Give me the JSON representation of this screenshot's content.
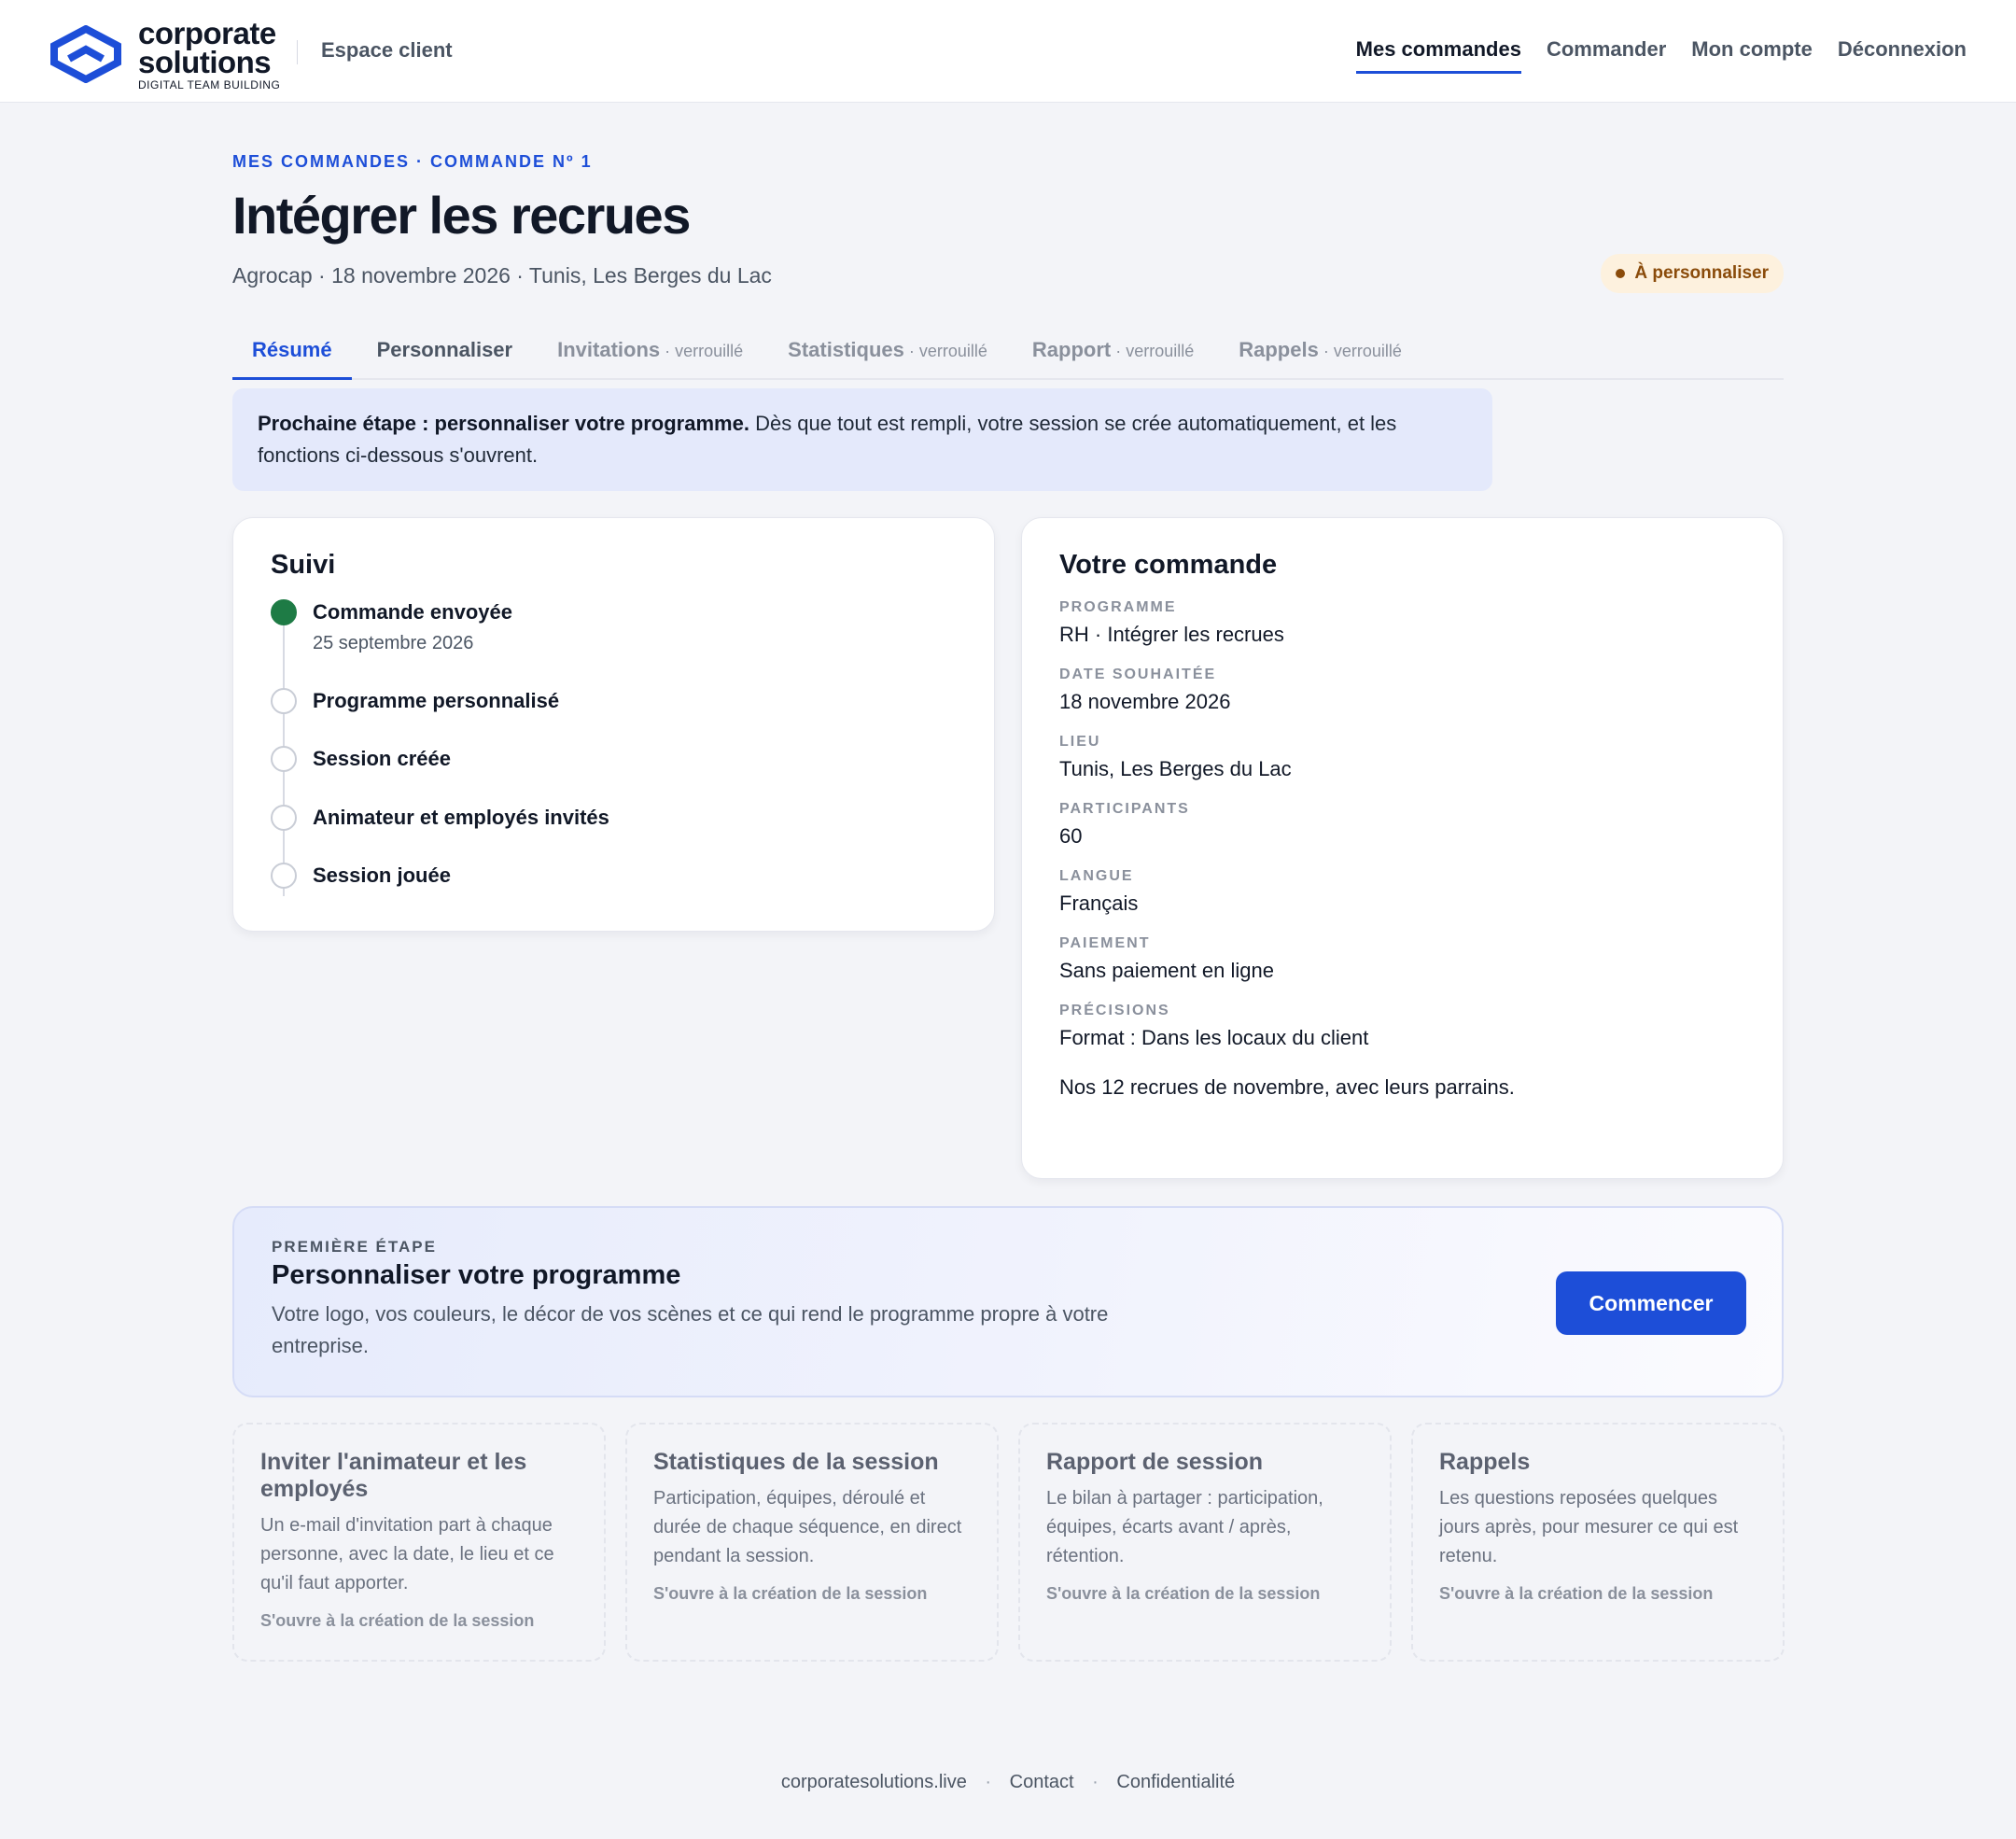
{
  "header": {
    "logo_word_1": "corporate",
    "logo_word_2": "solutions",
    "logo_tagline": "DIGITAL TEAM BUILDING",
    "section": "Espace client",
    "nav": [
      {
        "label": "Mes commandes",
        "active": true
      },
      {
        "label": "Commander"
      },
      {
        "label": "Mon compte"
      },
      {
        "label": "Déconnexion"
      }
    ]
  },
  "page": {
    "breadcrumb": "MES COMMANDES · COMMANDE Nº 1",
    "title": "Intégrer les recrues",
    "subtitle": "Agrocap · 18 novembre 2026 · Tunis, Les Berges du Lac",
    "status_badge": "À personnaliser"
  },
  "tabs": [
    {
      "label": "Résumé",
      "active": true
    },
    {
      "label": "Personnaliser"
    },
    {
      "label": "Invitations",
      "suffix": " · verrouillé"
    },
    {
      "label": "Statistiques",
      "suffix": " · verrouillé"
    },
    {
      "label": "Rapport",
      "suffix": " · verrouillé"
    },
    {
      "label": "Rappels",
      "suffix": " · verrouillé"
    }
  ],
  "banner": {
    "bold": "Prochaine étape : personnaliser votre programme.",
    "text": " Dès que tout est rempli, votre session se crée automatiquement, et les fonctions ci-dessous s'ouvrent."
  },
  "suivi": {
    "title": "Suivi",
    "steps": [
      {
        "label": "Commande envoyée",
        "date": "25 septembre 2026",
        "done": true
      },
      {
        "label": "Programme personnalisé"
      },
      {
        "label": "Session créée"
      },
      {
        "label": "Animateur et employés invités"
      },
      {
        "label": "Session jouée"
      }
    ]
  },
  "commande": {
    "title": "Votre commande",
    "fields": [
      {
        "label": "PROGRAMME",
        "value": "RH · Intégrer les recrues"
      },
      {
        "label": "DATE SOUHAITÉE",
        "value": "18 novembre 2026"
      },
      {
        "label": "LIEU",
        "value": "Tunis, Les Berges du Lac"
      },
      {
        "label": "PARTICIPANTS",
        "value": "60"
      },
      {
        "label": "LANGUE",
        "value": "Français"
      },
      {
        "label": "PAIEMENT",
        "value": "Sans paiement en ligne"
      },
      {
        "label": "PRÉCISIONS",
        "value": "Format : Dans les locaux du client"
      }
    ],
    "note": "Nos 12 recrues de novembre, avec leurs parrains."
  },
  "cta": {
    "eyebrow": "PREMIÈRE ÉTAPE",
    "title": "Personnaliser votre programme",
    "description": "Votre logo, vos couleurs, le décor de vos scènes et ce qui rend le programme propre à votre entreprise.",
    "button": "Commencer"
  },
  "features": [
    {
      "title": "Inviter l'animateur et les employés",
      "desc": "Un e-mail d'invitation part à chaque personne, avec la date, le lieu et ce qu'il faut apporter.",
      "foot": "S'ouvre à la création de la session"
    },
    {
      "title": "Statistiques de la session",
      "desc": "Participation, équipes, déroulé et durée de chaque séquence, en direct pendant la session.",
      "foot": "S'ouvre à la création de la session"
    },
    {
      "title": "Rapport de session",
      "desc": "Le bilan à partager : participation, équipes, écarts avant / après, rétention.",
      "foot": "S'ouvre à la création de la session"
    },
    {
      "title": "Rappels",
      "desc": "Les questions reposées quelques jours après, pour mesurer ce qui est retenu.",
      "foot": "S'ouvre à la création de la session"
    }
  ],
  "footer": {
    "links": [
      "corporatesolutions.live",
      "Contact",
      "Confidentialité"
    ],
    "separator": "·"
  },
  "colors": {
    "accent": "#1d4ed8",
    "done": "#1e7b45",
    "badge_bg": "#fdf1de",
    "badge_text": "#8a4b0a"
  }
}
